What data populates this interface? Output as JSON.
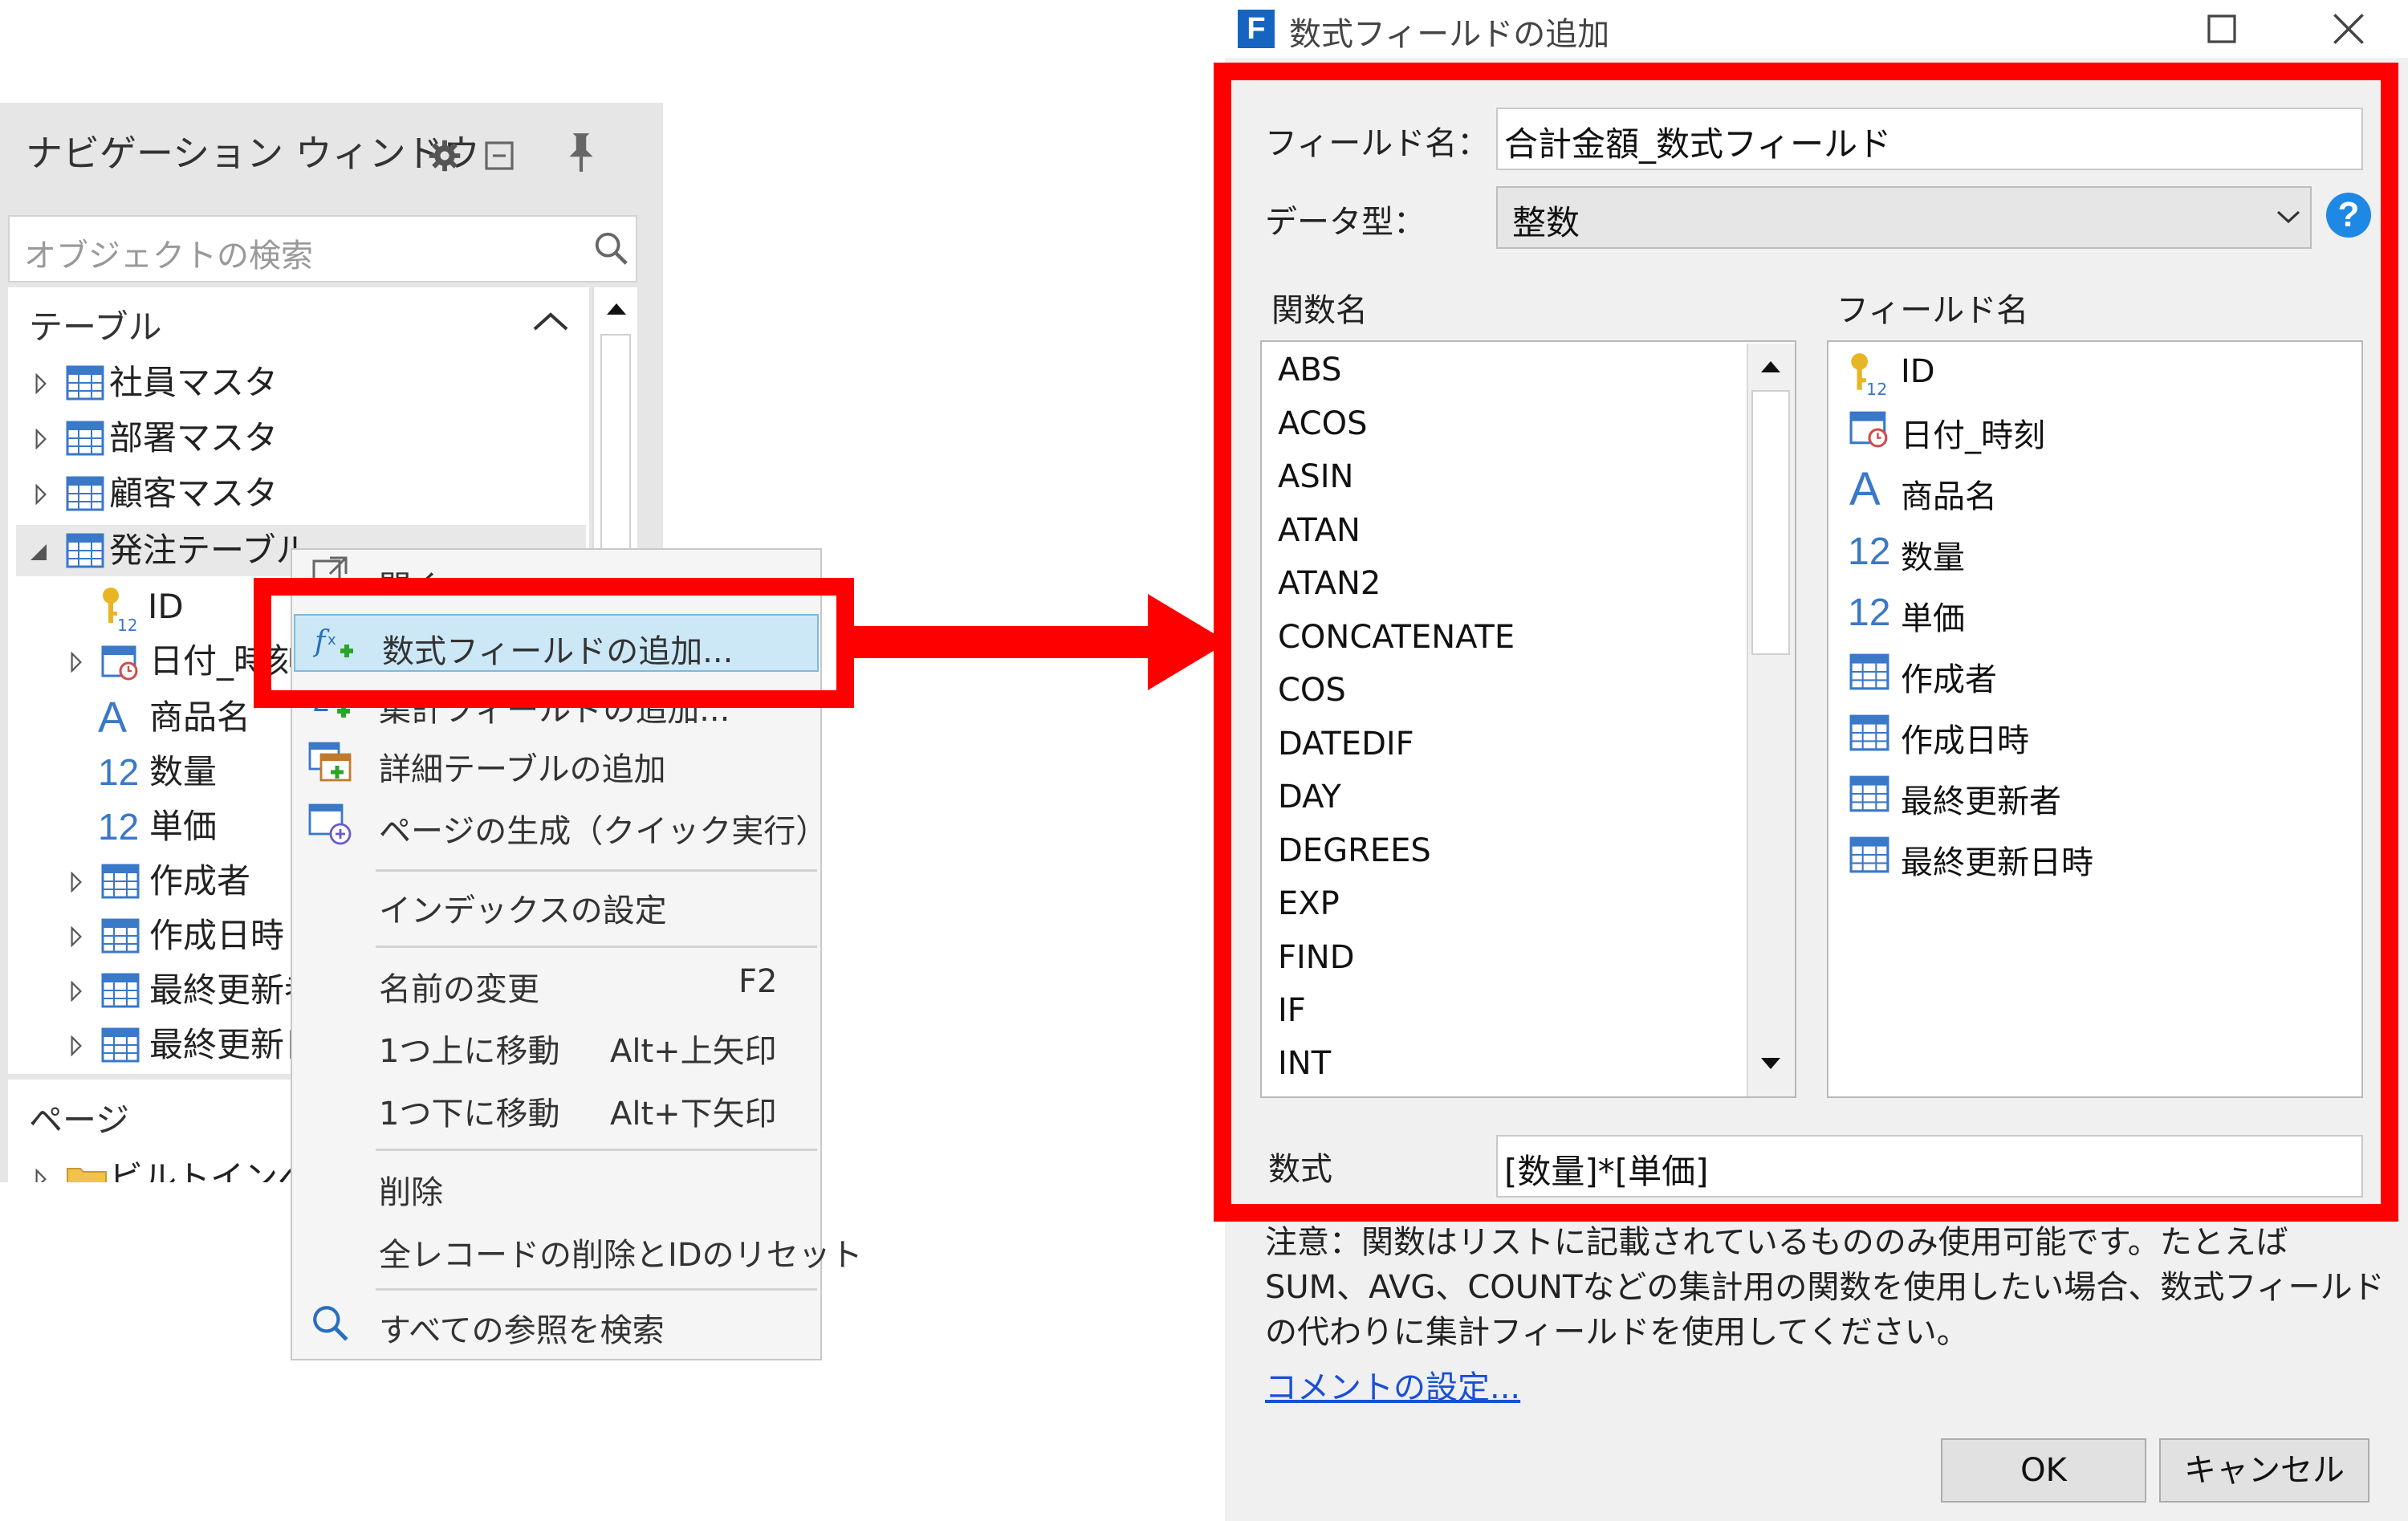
{
  "nav": {
    "title": "ナビゲーション ウィンドウ",
    "search_placeholder": "オブジェクトの検索",
    "section_tables": "テーブル",
    "section_pages": "ページ",
    "tables": [
      "社員マスタ",
      "部署マスタ",
      "顧客マスタ",
      "発注テーブル"
    ],
    "fields": [
      {
        "label": "ID",
        "icon": "key-number-icon"
      },
      {
        "label": "日付_時刻",
        "icon": "calendar-icon"
      },
      {
        "label": "商品名",
        "icon": "text-a-icon"
      },
      {
        "label": "数量",
        "icon": "number-12-icon"
      },
      {
        "label": "単価",
        "icon": "number-12-icon"
      },
      {
        "label": "作成者",
        "icon": "table-icon"
      },
      {
        "label": "作成日時",
        "icon": "table-icon"
      },
      {
        "label": "最終更新者",
        "icon": "table-icon"
      },
      {
        "label": "最終更新日時",
        "icon": "table-icon"
      }
    ],
    "pages_item": "ビルトインページ"
  },
  "context_menu": {
    "open": "開く",
    "items": [
      {
        "label": "数式フィールドの追加...",
        "shortcut": ""
      },
      {
        "label": "集計フィールドの追加...",
        "shortcut": ""
      },
      {
        "label": "詳細テーブルの追加",
        "shortcut": ""
      },
      {
        "label": "ページの生成（クイック実行）",
        "shortcut": ""
      },
      {
        "label": "インデックスの設定",
        "shortcut": ""
      },
      {
        "label": "名前の変更",
        "shortcut": "F2"
      },
      {
        "label": "1つ上に移動",
        "shortcut": "Alt+上矢印"
      },
      {
        "label": "1つ下に移動",
        "shortcut": "Alt+下矢印"
      },
      {
        "label": "削除",
        "shortcut": ""
      },
      {
        "label": "全レコードの削除とIDのリセット",
        "shortcut": ""
      },
      {
        "label": "すべての参照を検索",
        "shortcut": ""
      }
    ]
  },
  "dialog": {
    "app_icon_letter": "F",
    "title": "数式フィールドの追加",
    "field_name_label": "フィールド名：",
    "field_name_value": "合計金額_数式フィールド",
    "data_type_label": "データ型：",
    "data_type_value": "整数",
    "help_glyph": "?",
    "functions_label": "関数名",
    "fields_label": "フィールド名",
    "functions": [
      "ABS",
      "ACOS",
      "ASIN",
      "ATAN",
      "ATAN2",
      "CONCATENATE",
      "COS",
      "DATEDIF",
      "DAY",
      "DEGREES",
      "EXP",
      "FIND",
      "IF",
      "INT"
    ],
    "field_list": [
      {
        "label": "ID",
        "icon": "key-number-icon"
      },
      {
        "label": "日付_時刻",
        "icon": "calendar-icon"
      },
      {
        "label": "商品名",
        "icon": "text-a-icon"
      },
      {
        "label": "数量",
        "icon": "number-12-icon"
      },
      {
        "label": "単価",
        "icon": "number-12-icon"
      },
      {
        "label": "作成者",
        "icon": "table-icon"
      },
      {
        "label": "作成日時",
        "icon": "table-icon"
      },
      {
        "label": "最終更新者",
        "icon": "table-icon"
      },
      {
        "label": "最終更新日時",
        "icon": "table-icon"
      }
    ],
    "formula_label": "数式",
    "formula_value": "[数量]*[単価]",
    "note": "注意：関数はリストに記載されているもののみ使用可能です。たとえばSUM、AVG、COUNTなどの集計用の関数を使用したい場合、数式フィールドの代わりに集計フィールドを使用してください。",
    "comment_link": "コメントの設定...",
    "ok_label": "OK",
    "cancel_label": "キャンセル"
  },
  "colors": {
    "highlight": "#ff0000",
    "selection": "#cce8f7",
    "link": "#1a4fd6",
    "help": "#1e88e5"
  }
}
